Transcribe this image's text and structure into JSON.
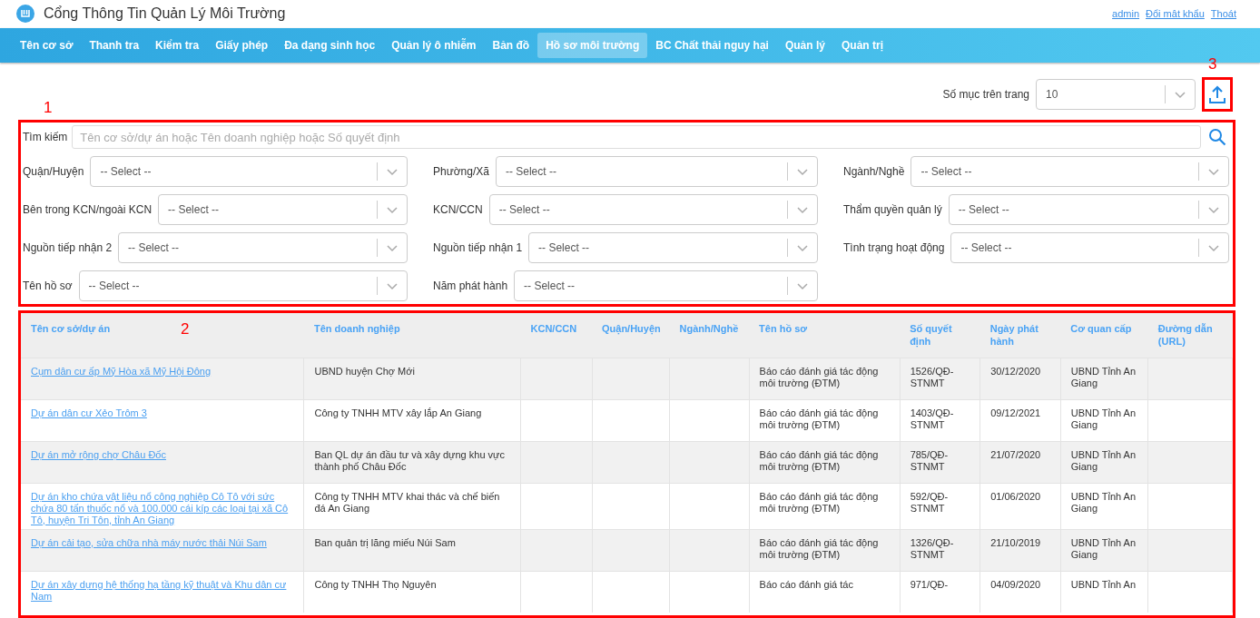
{
  "header": {
    "title": "Cổng Thông Tin Quản Lý Môi Trường",
    "user_links": [
      "admin",
      "Đổi mật khẩu",
      "Thoát"
    ]
  },
  "nav": [
    {
      "label": "Tên cơ sở",
      "selected": false
    },
    {
      "label": "Thanh tra",
      "selected": false
    },
    {
      "label": "Kiểm tra",
      "selected": false
    },
    {
      "label": "Giấy phép",
      "selected": false
    },
    {
      "label": "Đa dạng sinh học",
      "selected": false
    },
    {
      "label": "Quản lý ô nhiễm",
      "selected": false
    },
    {
      "label": "Bản đồ",
      "selected": false
    },
    {
      "label": "Hồ sơ môi trường",
      "selected": true
    },
    {
      "label": "BC Chất thải nguy hại",
      "selected": false
    },
    {
      "label": "Quản lý",
      "selected": false
    },
    {
      "label": "Quản trị",
      "selected": false
    }
  ],
  "page_size": {
    "label": "Số mục trên trang",
    "value": "10"
  },
  "export_button": {
    "annotation": "3"
  },
  "filters": {
    "annotation": "1",
    "search": {
      "label": "Tìm kiếm",
      "placeholder": "Tên cơ sở/dự án hoặc Tên doanh nghiệp hoặc Số quyết định"
    },
    "selects": [
      [
        {
          "label": "Quận/Huyện",
          "placeholder": "-- Select --"
        },
        {
          "label": "Phường/Xã",
          "placeholder": "-- Select --"
        },
        {
          "label": "Ngành/Nghề",
          "placeholder": "-- Select --"
        }
      ],
      [
        {
          "label": "Bên trong KCN/ngoài KCN",
          "placeholder": "-- Select --"
        },
        {
          "label": "KCN/CCN",
          "placeholder": "-- Select --"
        },
        {
          "label": "Thẩm quyền quản lý",
          "placeholder": "-- Select --"
        }
      ],
      [
        {
          "label": "Nguồn tiếp nhận 2",
          "placeholder": "-- Select --"
        },
        {
          "label": "Nguồn tiếp nhận 1",
          "placeholder": "-- Select --"
        },
        {
          "label": "Tình trạng hoạt động",
          "placeholder": "-- Select --"
        }
      ],
      [
        {
          "label": "Tên hồ sơ",
          "placeholder": "-- Select --"
        },
        {
          "label": "Năm phát hành",
          "placeholder": "-- Select --"
        }
      ]
    ]
  },
  "table": {
    "annotation": "2",
    "columns": [
      "Tên cơ sở/dự án",
      "Tên doanh nghiệp",
      "KCN/CCN",
      "Quận/Huyện",
      "Ngành/Nghề",
      "Tên hồ sơ",
      "Số quyết định",
      "Ngày phát hành",
      "Cơ quan cấp",
      "Đường dẫn (URL)"
    ],
    "rows": [
      [
        "Cụm dân cư ấp Mỹ Hòa xã Mỹ Hội Đông",
        "UBND huyện Chợ Mới",
        "",
        "",
        "",
        "Báo cáo đánh giá tác động môi trường (ĐTM)",
        "1526/QĐ-STNMT",
        "30/12/2020",
        "UBND Tỉnh An Giang",
        ""
      ],
      [
        "Dự án dân cư Xẻo Trôm 3",
        "Công ty TNHH MTV xây lắp An Giang",
        "",
        "",
        "",
        "Báo cáo đánh giá tác động môi trường (ĐTM)",
        "1403/QĐ-STNMT",
        "09/12/2021",
        "UBND Tỉnh An Giang",
        ""
      ],
      [
        "Dự án mở rộng chợ Châu Đốc",
        "Ban QL dự án đầu tư và xây dựng khu vực thành phố Châu Đốc",
        "",
        "",
        "",
        "Báo cáo đánh giá tác động môi trường (ĐTM)",
        "785/QĐ-STNMT",
        "21/07/2020",
        "UBND Tỉnh An Giang",
        ""
      ],
      [
        "Dự án kho chứa vật liệu nổ công nghiệp Cô Tô với sức chứa 80 tấn thuốc nổ và 100.000 cái kíp các loại tại xã Cô Tô, huyện Tri Tôn, tỉnh An Giang",
        "Công ty TNHH MTV khai thác và chế biến đá An Giang",
        "",
        "",
        "",
        "Báo cáo đánh giá tác động môi trường (ĐTM)",
        "592/QĐ-STNMT",
        "01/06/2020",
        "UBND Tỉnh An Giang",
        ""
      ],
      [
        "Dự án cải tạo, sửa chữa nhà máy nước thải Núi Sam",
        "Ban quản trị lăng miếu Núi Sam",
        "",
        "",
        "",
        "Báo cáo đánh giá tác động môi trường (ĐTM)",
        "1326/QĐ-STNMT",
        "21/10/2019",
        "UBND Tỉnh An Giang",
        ""
      ],
      [
        "Dự án xây dựng hệ thống hạ tầng kỹ thuật và Khu dân cư Nam",
        "Công ty TNHH Thọ Nguyên",
        "",
        "",
        "",
        "Báo cáo đánh giá tác",
        "971/QĐ-",
        "04/09/2020",
        "UBND Tỉnh An",
        ""
      ]
    ]
  }
}
